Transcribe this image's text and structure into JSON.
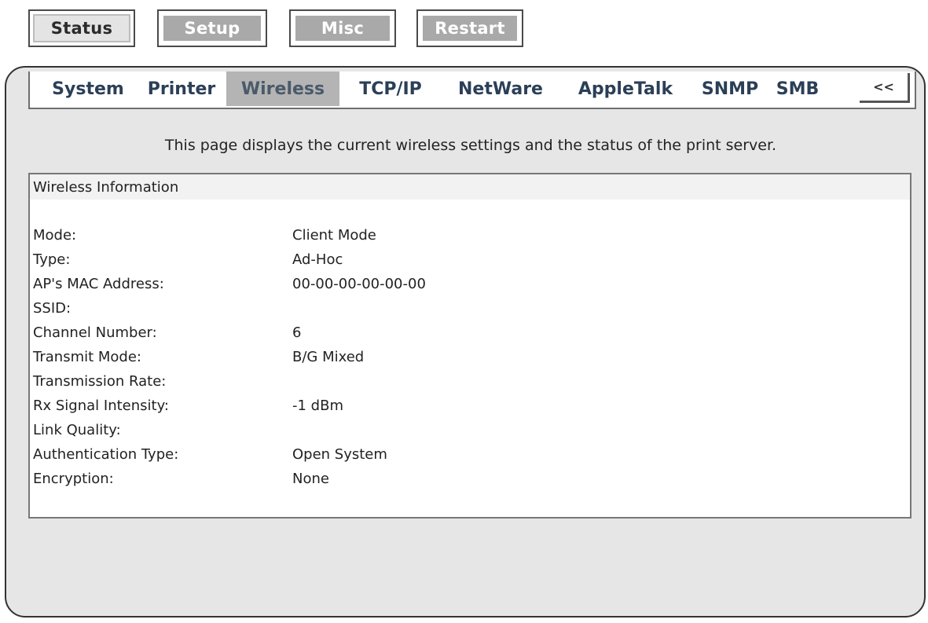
{
  "top_nav": [
    "Status",
    "Setup",
    "Misc",
    "Restart"
  ],
  "tabs": [
    "System",
    "Printer",
    "Wireless",
    "TCP/IP",
    "NetWare",
    "AppleTalk",
    "SNMP",
    "SMB"
  ],
  "collapse_label": "<<",
  "intro_text": "This page displays the current wireless settings and the status of the print server.",
  "section_title": "Wireless Information",
  "rows": [
    {
      "label": "Mode:",
      "value": "Client Mode"
    },
    {
      "label": "Type:",
      "value": "Ad-Hoc"
    },
    {
      "label": "AP's MAC Address:",
      "value": "00-00-00-00-00-00"
    },
    {
      "label": "SSID:",
      "value": ""
    },
    {
      "label": "Channel Number:",
      "value": "6"
    },
    {
      "label": "Transmit Mode:",
      "value": "B/G Mixed"
    },
    {
      "label": "Transmission Rate:",
      "value": ""
    },
    {
      "label": "Rx Signal Intensity:",
      "value": "-1 dBm"
    },
    {
      "label": "Link Quality:",
      "value": ""
    },
    {
      "label": "Authentication Type:",
      "value": "Open System"
    },
    {
      "label": "Encryption:",
      "value": "None"
    }
  ]
}
